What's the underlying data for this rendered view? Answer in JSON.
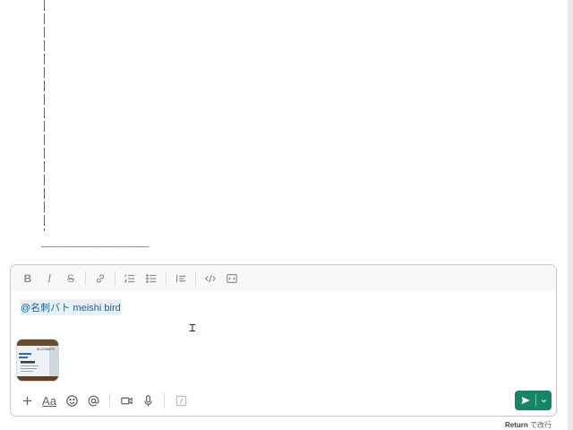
{
  "history": {
    "ascii_rule": "________________"
  },
  "composer": {
    "formatting": {
      "bold_label": "B",
      "italic_label": "I",
      "strike_label": "S"
    },
    "message": {
      "mention_text": "@名刺バト meishi bird"
    },
    "attachment": {
      "kind": "image",
      "thumbnail_text": "ALGOMATIC"
    },
    "bottom": {
      "format_label": "Aa"
    },
    "send": {
      "color": "#148567"
    }
  },
  "hint": {
    "key": "Return",
    "action": "で改行"
  }
}
